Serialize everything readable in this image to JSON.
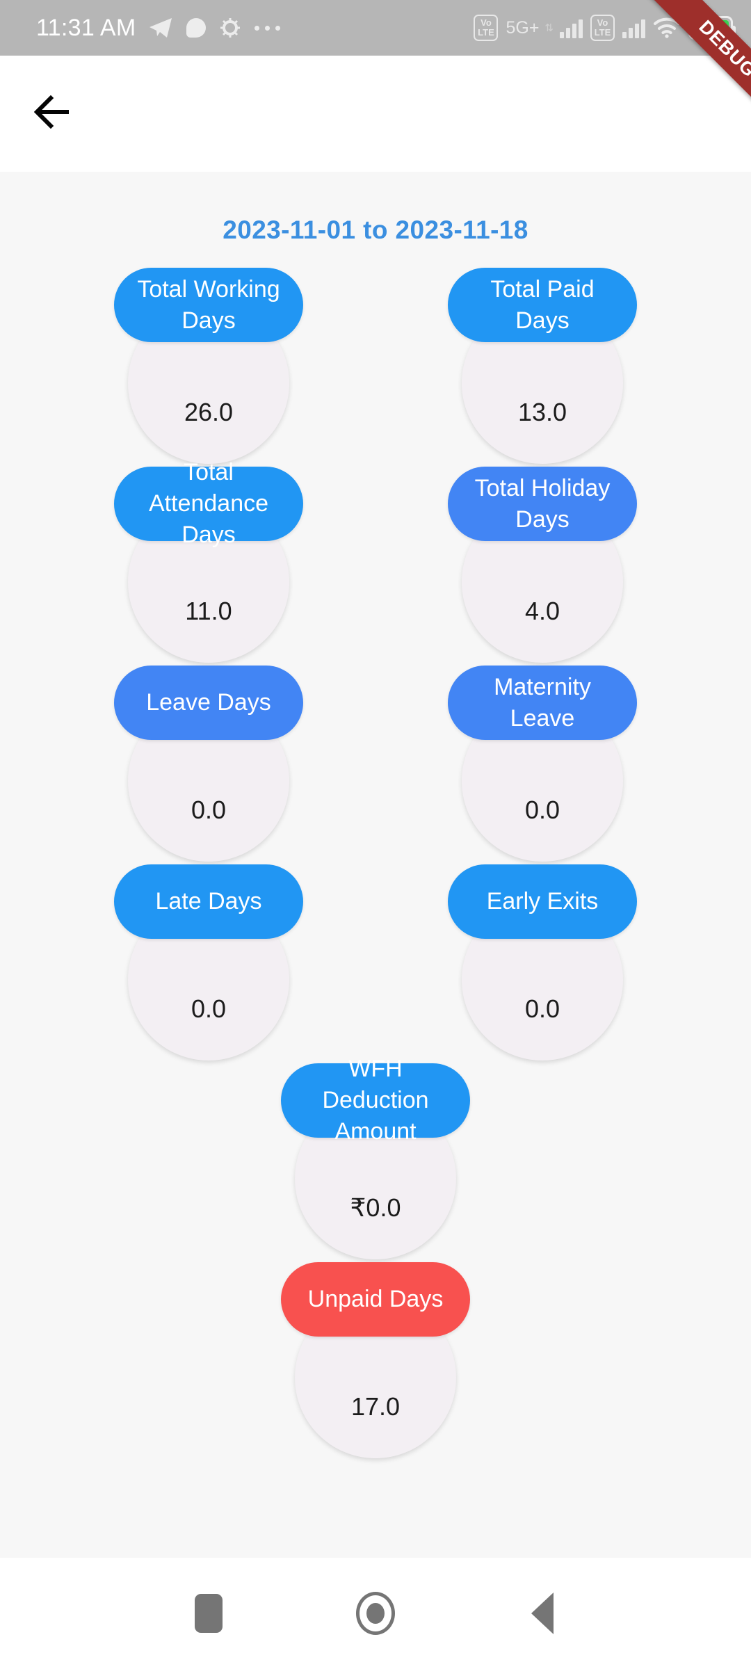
{
  "status_bar": {
    "time": "11:31 AM",
    "left_icons": [
      "telegram-icon",
      "chat-icon",
      "gear-icon",
      "more-dots-icon"
    ],
    "sim1_volte": "Vo\nLTE",
    "sim1_volte_top": "Vo",
    "sim1_volte_bottom": "LTE",
    "network_label": "5G+",
    "data_arrows": "⇅",
    "sim2_volte_top": "Vo",
    "sim2_volte_bottom": "LTE",
    "wifi_icon": "wifi-icon",
    "battery_level": "60"
  },
  "debug_ribbon": {
    "label": "DEBUG",
    "color": "#9E2F2B"
  },
  "app_bar": {
    "back_icon": "arrow-back-icon"
  },
  "main": {
    "date_range_title": "2023-11-01 to 2023-11-18",
    "title_color": "#3B8FE0",
    "circle_color": "#F3EFF3",
    "cards": [
      {
        "label_line1": "Total Working",
        "label_line2": "Days",
        "value": "26.0",
        "color": "#2196F3"
      },
      {
        "label_line1": "Total Paid",
        "label_line2": "Days",
        "value": "13.0",
        "color": "#2196F3"
      },
      {
        "label_line1": "Total Attendance",
        "label_line2": "Days",
        "value": "11.0",
        "color": "#2196F3"
      },
      {
        "label_line1": "Total Holiday",
        "label_line2": "Days",
        "value": "4.0",
        "color": "#4285F4"
      },
      {
        "label_line1": "Leave Days",
        "label_line2": "",
        "value": "0.0",
        "color": "#4285F4"
      },
      {
        "label_line1": "Maternity",
        "label_line2": "Leave",
        "value": "0.0",
        "color": "#4285F4"
      },
      {
        "label_line1": "Late Days",
        "label_line2": "",
        "value": "0.0",
        "color": "#2196F3"
      },
      {
        "label_line1": "Early Exits",
        "label_line2": "",
        "value": "0.0",
        "color": "#2196F3"
      },
      {
        "label_line1": "WFH Deduction",
        "label_line2": "Amount",
        "value": "₹0.0",
        "color": "#2196F3"
      },
      {
        "label_line1": "Unpaid Days",
        "label_line2": "",
        "value": "17.0",
        "color": "#F8514F"
      }
    ]
  },
  "nav_bar": {
    "recents_icon": "recents-square-icon",
    "home_icon": "home-circle-icon",
    "back_icon": "back-triangle-icon"
  }
}
